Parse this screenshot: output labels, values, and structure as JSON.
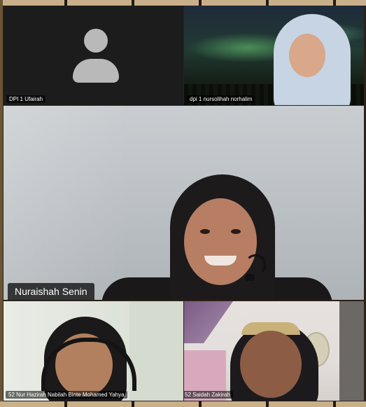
{
  "participants": {
    "p1": {
      "name": "DPI 1 Ufairah"
    },
    "p2": {
      "name": "dpi 1 nursolihah norhalim"
    },
    "speaker": {
      "name": "Nuraishah Senin"
    },
    "p3": {
      "name": "52 Nur Hazirah Nabilah Binte Mohamed Yahya"
    },
    "p4": {
      "name": "52 Saidah Zakirah"
    }
  },
  "colors": {
    "tile_dark": "#1c1c1c",
    "avatar_grey": "#b9b9b9",
    "name_tag_bg": "#000000"
  },
  "icons": {
    "avatar_placeholder": "user-silhouette-icon"
  }
}
